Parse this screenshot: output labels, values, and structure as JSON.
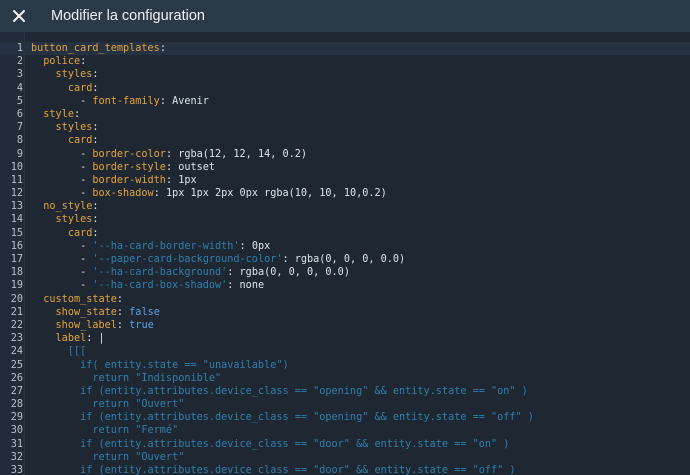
{
  "header": {
    "title": "Modifier la configuration",
    "close_icon": "close-icon"
  },
  "colors": {
    "header_bg": "#2c3947",
    "editor_bg": "#1e2732",
    "key": "#e6a43a",
    "string": "#2f80ad",
    "boolean": "#5ea3e4",
    "plain": "#dde3ea"
  },
  "editor": {
    "active_line": 1,
    "lines": [
      {
        "n": "1",
        "segs": [
          {
            "t": "button_card_templates",
            "c": "k"
          },
          {
            "t": ":",
            "c": "p"
          }
        ]
      },
      {
        "n": "2",
        "segs": [
          {
            "t": "  "
          },
          {
            "t": "police",
            "c": "k"
          },
          {
            "t": ":",
            "c": "p"
          }
        ]
      },
      {
        "n": "3",
        "segs": [
          {
            "t": "    "
          },
          {
            "t": "styles",
            "c": "k"
          },
          {
            "t": ":",
            "c": "p"
          }
        ]
      },
      {
        "n": "4",
        "segs": [
          {
            "t": "      "
          },
          {
            "t": "card",
            "c": "k"
          },
          {
            "t": ":",
            "c": "p"
          }
        ]
      },
      {
        "n": "5",
        "segs": [
          {
            "t": "        - "
          },
          {
            "t": "font-family",
            "c": "k"
          },
          {
            "t": ": Avenir",
            "c": "p"
          }
        ]
      },
      {
        "n": "6",
        "segs": [
          {
            "t": "  "
          },
          {
            "t": "style",
            "c": "k"
          },
          {
            "t": ":",
            "c": "p"
          }
        ]
      },
      {
        "n": "7",
        "segs": [
          {
            "t": "    "
          },
          {
            "t": "styles",
            "c": "k"
          },
          {
            "t": ":",
            "c": "p"
          }
        ]
      },
      {
        "n": "8",
        "segs": [
          {
            "t": "      "
          },
          {
            "t": "card",
            "c": "k"
          },
          {
            "t": ":",
            "c": "p"
          }
        ]
      },
      {
        "n": "9",
        "segs": [
          {
            "t": "        - "
          },
          {
            "t": "border-color",
            "c": "k"
          },
          {
            "t": ": rgba(12, 12, 14, 0.2)",
            "c": "p"
          }
        ]
      },
      {
        "n": "10",
        "segs": [
          {
            "t": "        - "
          },
          {
            "t": "border-style",
            "c": "k"
          },
          {
            "t": ": outset",
            "c": "p"
          }
        ]
      },
      {
        "n": "11",
        "segs": [
          {
            "t": "        - "
          },
          {
            "t": "border-width",
            "c": "k"
          },
          {
            "t": ": 1px",
            "c": "p"
          }
        ]
      },
      {
        "n": "12",
        "segs": [
          {
            "t": "        - "
          },
          {
            "t": "box-shadow",
            "c": "k"
          },
          {
            "t": ": 1px 1px 2px 0px rgba(10, 10, 10,0.2)",
            "c": "p"
          }
        ]
      },
      {
        "n": "13",
        "segs": [
          {
            "t": "  "
          },
          {
            "t": "no_style",
            "c": "k"
          },
          {
            "t": ":",
            "c": "p"
          }
        ]
      },
      {
        "n": "14",
        "segs": [
          {
            "t": "    "
          },
          {
            "t": "styles",
            "c": "k"
          },
          {
            "t": ":",
            "c": "p"
          }
        ]
      },
      {
        "n": "15",
        "segs": [
          {
            "t": "      "
          },
          {
            "t": "card",
            "c": "k"
          },
          {
            "t": ":",
            "c": "p"
          }
        ]
      },
      {
        "n": "16",
        "segs": [
          {
            "t": "        - "
          },
          {
            "t": "'--ha-card-border-width'",
            "c": "s"
          },
          {
            "t": ": 0px",
            "c": "p"
          }
        ]
      },
      {
        "n": "17",
        "segs": [
          {
            "t": "        - "
          },
          {
            "t": "'--paper-card-background-color'",
            "c": "s"
          },
          {
            "t": ": rgba(0, 0, 0, 0.0)",
            "c": "p"
          }
        ]
      },
      {
        "n": "18",
        "segs": [
          {
            "t": "        - "
          },
          {
            "t": "'--ha-card-background'",
            "c": "s"
          },
          {
            "t": ": rgba(0, 0, 0, 0.0)",
            "c": "p"
          }
        ]
      },
      {
        "n": "19",
        "segs": [
          {
            "t": "        - "
          },
          {
            "t": "'--ha-card-box-shadow'",
            "c": "s"
          },
          {
            "t": ": none",
            "c": "p"
          }
        ]
      },
      {
        "n": "20",
        "segs": [
          {
            "t": "  "
          },
          {
            "t": "custom_state",
            "c": "k"
          },
          {
            "t": ":",
            "c": "p"
          }
        ]
      },
      {
        "n": "21",
        "segs": [
          {
            "t": "    "
          },
          {
            "t": "show_state",
            "c": "k"
          },
          {
            "t": ": ",
            "c": "p"
          },
          {
            "t": "false",
            "c": "b"
          }
        ]
      },
      {
        "n": "22",
        "segs": [
          {
            "t": "    "
          },
          {
            "t": "show_label",
            "c": "k"
          },
          {
            "t": ": ",
            "c": "p"
          },
          {
            "t": "true",
            "c": "b"
          }
        ]
      },
      {
        "n": "23",
        "segs": [
          {
            "t": "    "
          },
          {
            "t": "label",
            "c": "k"
          },
          {
            "t": ": |",
            "c": "p"
          }
        ]
      },
      {
        "n": "24",
        "segs": [
          {
            "t": "      [[[",
            "c": "s"
          }
        ]
      },
      {
        "n": "25",
        "segs": [
          {
            "t": "        if( entity.state == \"unavailable\")",
            "c": "s"
          }
        ]
      },
      {
        "n": "26",
        "segs": [
          {
            "t": "          return \"Indisponible\"",
            "c": "s"
          }
        ]
      },
      {
        "n": "27",
        "segs": [
          {
            "t": "        if (entity.attributes.device_class == \"opening\" && entity.state == \"on\" )",
            "c": "s"
          }
        ]
      },
      {
        "n": "28",
        "segs": [
          {
            "t": "          return \"Ouvert\"",
            "c": "s"
          }
        ]
      },
      {
        "n": "29",
        "segs": [
          {
            "t": "        if (entity.attributes.device_class == \"opening\" && entity.state == \"off\" )",
            "c": "s"
          }
        ]
      },
      {
        "n": "30",
        "segs": [
          {
            "t": "          return \"Fermé\"",
            "c": "s"
          }
        ]
      },
      {
        "n": "31",
        "segs": [
          {
            "t": "        if (entity.attributes.device_class == \"door\" && entity.state == \"on\" )",
            "c": "s"
          }
        ]
      },
      {
        "n": "32",
        "segs": [
          {
            "t": "          return \"Ouvert\"",
            "c": "s"
          }
        ]
      },
      {
        "n": "33",
        "segs": [
          {
            "t": "        if (entity.attributes.device_class == \"door\" && entity.state == \"off\" )",
            "c": "s"
          }
        ]
      }
    ]
  }
}
